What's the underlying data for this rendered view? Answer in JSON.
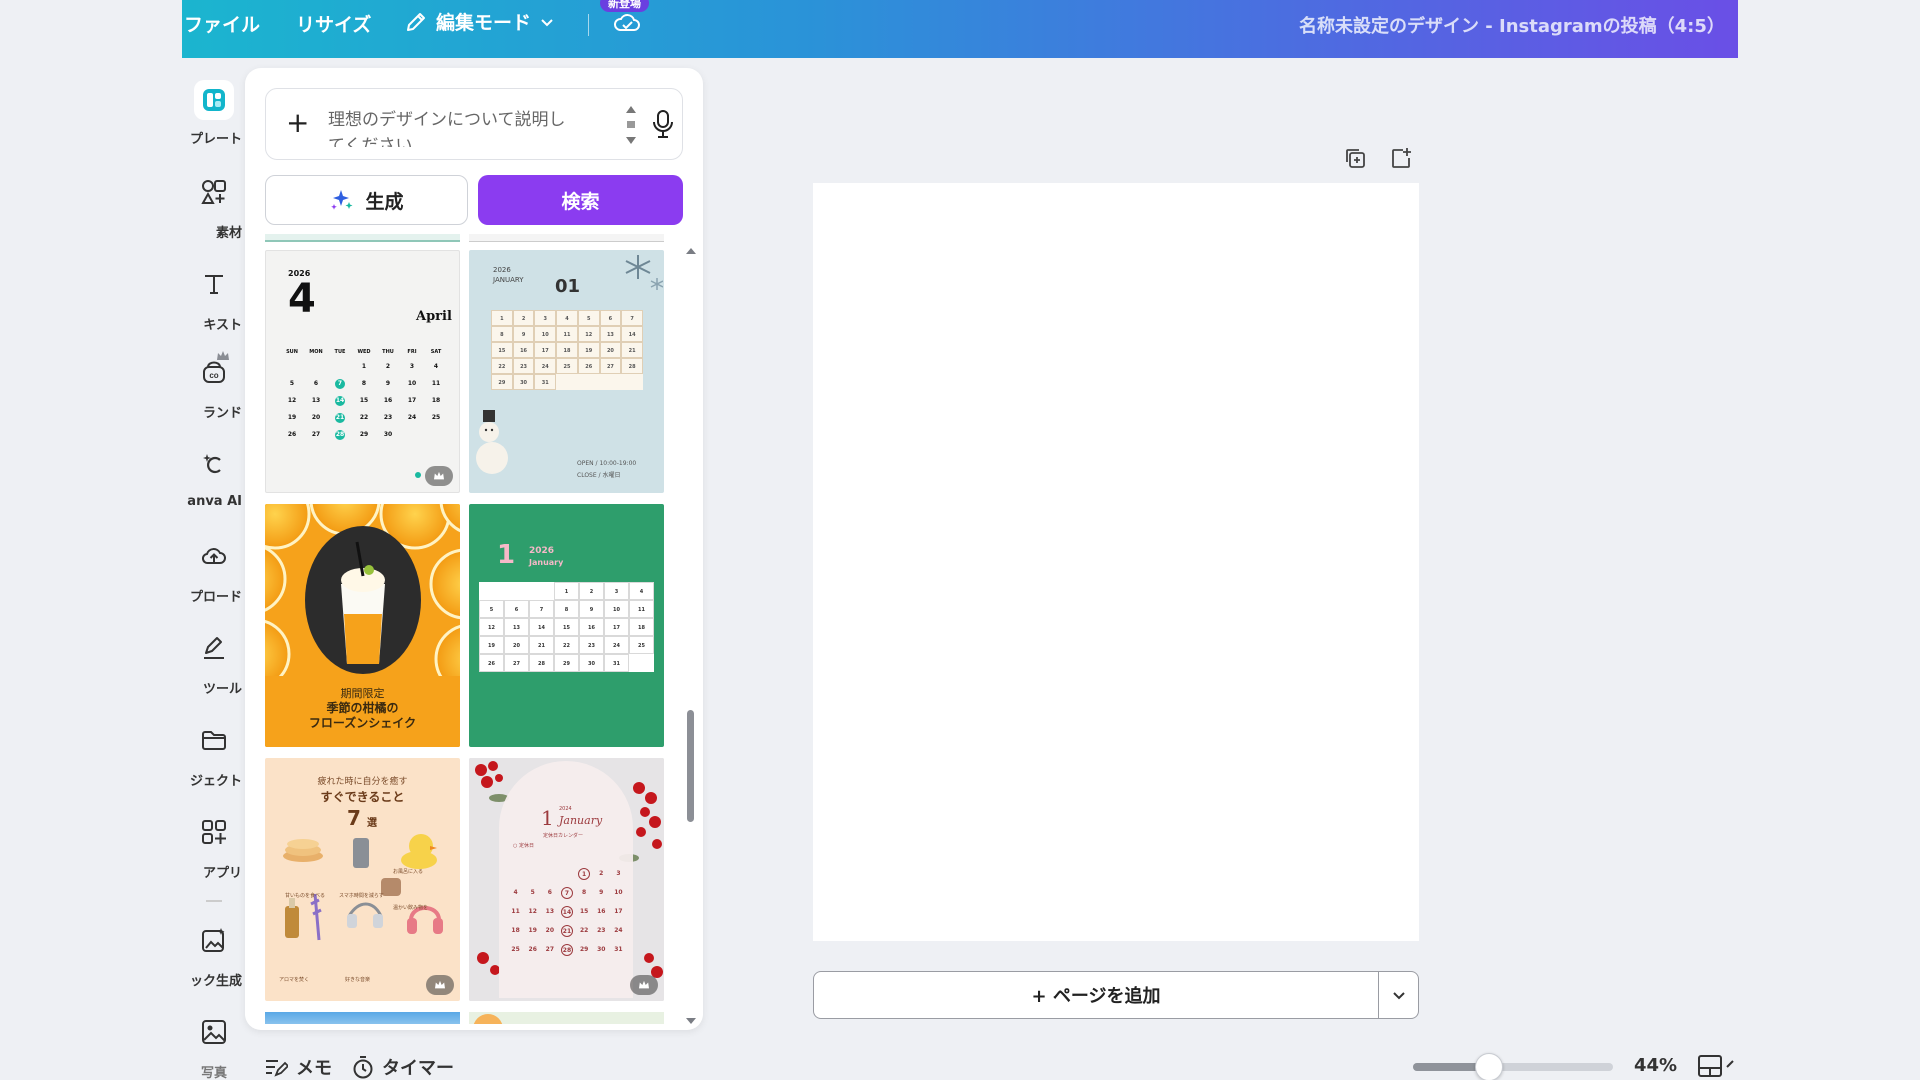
{
  "header": {
    "menu": [
      {
        "label": "ファイル"
      },
      {
        "label": "リサイズ"
      }
    ],
    "edit_mode": "編集モード",
    "new_badge": "新登場",
    "doc_title": "名称未設定のデザイン - Instagramの投稿（4:5）"
  },
  "rail": {
    "items": [
      {
        "label": "プレート",
        "icon": "template-icon"
      },
      {
        "label": "素材",
        "icon": "elements-icon"
      },
      {
        "label": "キスト",
        "icon": "text-icon"
      },
      {
        "label": "ランド",
        "icon": "brand-icon"
      },
      {
        "label": "anva AI",
        "icon": "canva-ai-icon"
      },
      {
        "label": "プロード",
        "icon": "upload-icon"
      },
      {
        "label": "ツール",
        "icon": "tools-icon"
      },
      {
        "label": "ジェクト",
        "icon": "projects-icon"
      },
      {
        "label": "アプリ",
        "icon": "apps-icon"
      },
      {
        "label": "ック生成",
        "icon": "magic-media-icon"
      },
      {
        "label": "写真",
        "icon": "photos-icon"
      }
    ]
  },
  "panel": {
    "prompt_text": "理想のデザインについて説明してください",
    "generate_label": "生成",
    "search_label": "検索",
    "templates": {
      "cal_april": {
        "year": "2026",
        "month_num": "4",
        "month_name": "April",
        "weekdays": [
          "SUN",
          "MON",
          "TUE",
          "WED",
          "THU",
          "FRI",
          "SAT"
        ]
      },
      "cal_winter": {
        "year": "2026",
        "month_word": "JANUARY",
        "month_num": "01",
        "open": "OPEN / 10:00-19:00",
        "close": "CLOSE / 水曜日"
      },
      "orange": {
        "line1": "期間限定",
        "line2": "季節の柑橘の",
        "line3": "フローズンシェイク"
      },
      "cal_green": {
        "month_num": "1",
        "year": "2026",
        "month_name": "January"
      },
      "selfcare": {
        "line1": "疲れた時に自分を癒す",
        "line2": "すぐできること",
        "count": "7",
        "unit": "選",
        "items": [
          "甘いものを食べる",
          "スマホ時間を減らす",
          "お風呂に入る",
          "温かい飲み物を",
          "アロマを焚く",
          "好きな音楽"
        ]
      },
      "cal_berry": {
        "month_num": "1",
        "month_name": "January",
        "year": "2024",
        "sub": "定休日カレンダー",
        "legend": "○ 定休日"
      }
    }
  },
  "canvas": {
    "add_page": "+ ページを追加"
  },
  "bottom": {
    "memo": "メモ",
    "timer": "タイマー",
    "zoom": "44%",
    "zoom_fraction": 0.38
  },
  "colors": {
    "accent": "#8b3cf0",
    "teal": "#19b9a0"
  }
}
